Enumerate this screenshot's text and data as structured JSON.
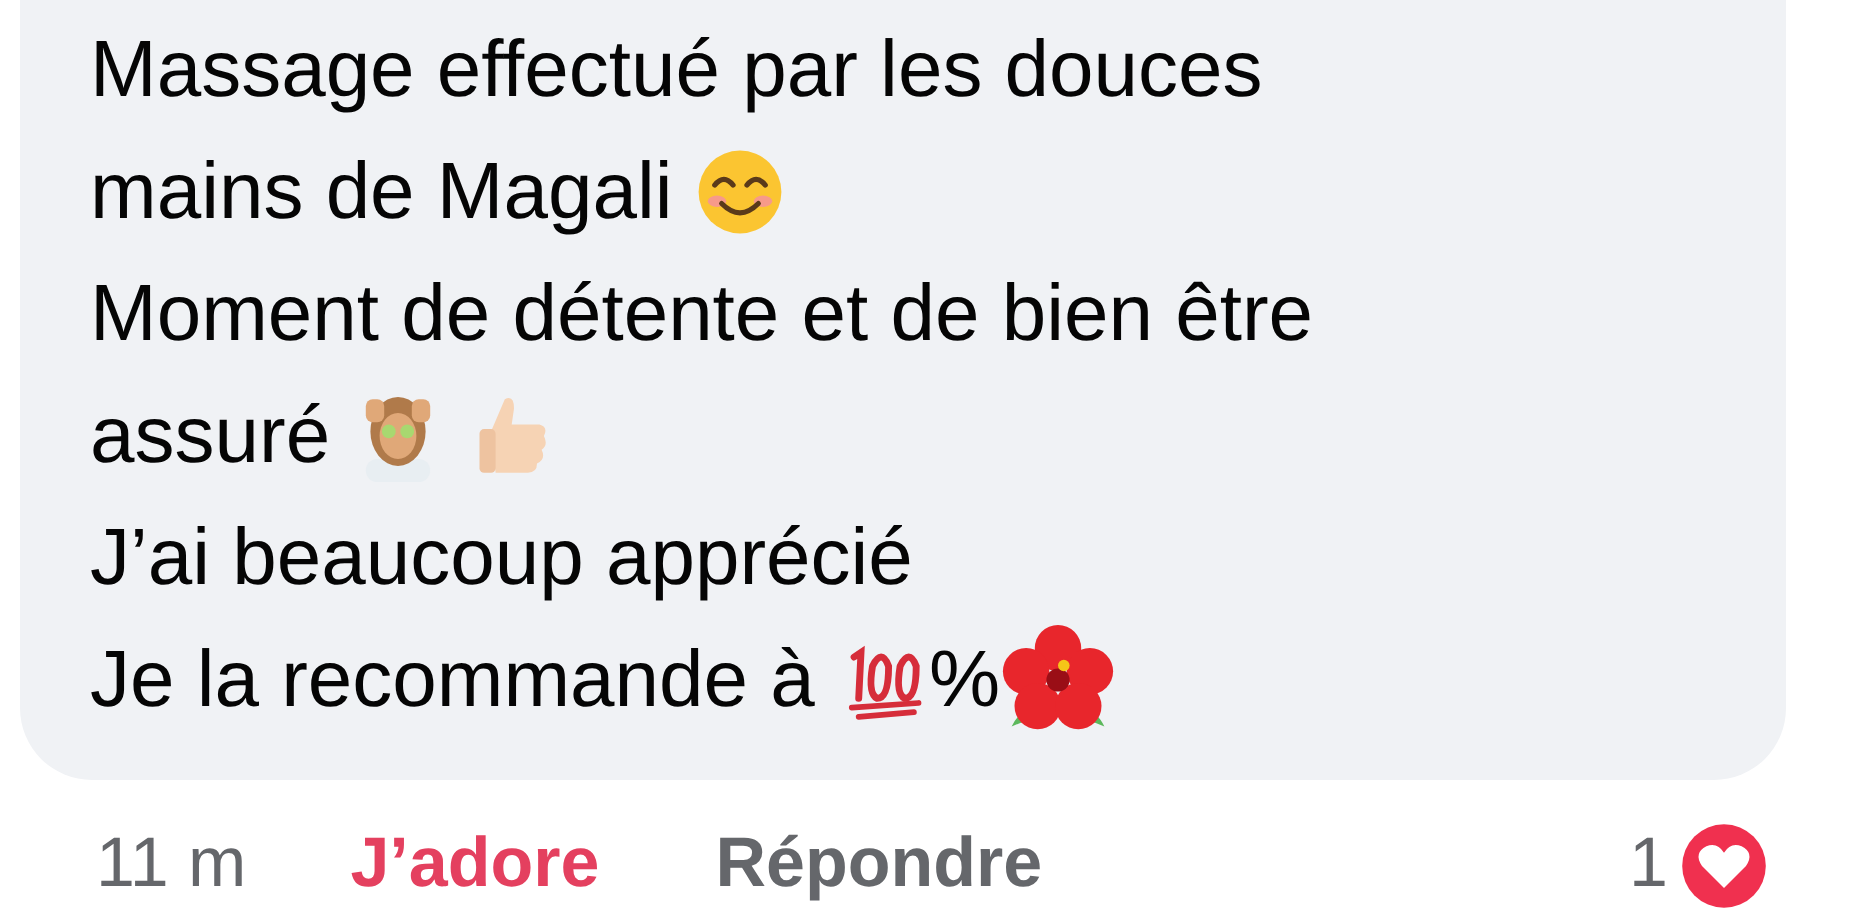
{
  "comment": {
    "lines": [
      [
        {
          "kind": "text",
          "text": "Massage effectué par les douces"
        }
      ],
      [
        {
          "kind": "text",
          "text": "mains de Magali "
        },
        {
          "kind": "smile"
        }
      ],
      [
        {
          "kind": "text",
          "text": "Moment de détente et de bien être"
        }
      ],
      [
        {
          "kind": "text",
          "text": "assuré "
        },
        {
          "kind": "spa"
        },
        {
          "kind": "gap"
        },
        {
          "kind": "thumb"
        }
      ],
      [
        {
          "kind": "text",
          "text": "J’ai beaucoup apprécié"
        }
      ],
      [
        {
          "kind": "text",
          "text": "Je la recommande à "
        },
        {
          "kind": "hundred"
        },
        {
          "kind": "text",
          "text": "%"
        },
        {
          "kind": "flower"
        }
      ]
    ]
  },
  "actions": {
    "time": "11 m",
    "like": {
      "label": "J’adore",
      "selected": true
    },
    "reply": "Répondre"
  },
  "reactions": {
    "count": "1",
    "kind": "love"
  }
}
